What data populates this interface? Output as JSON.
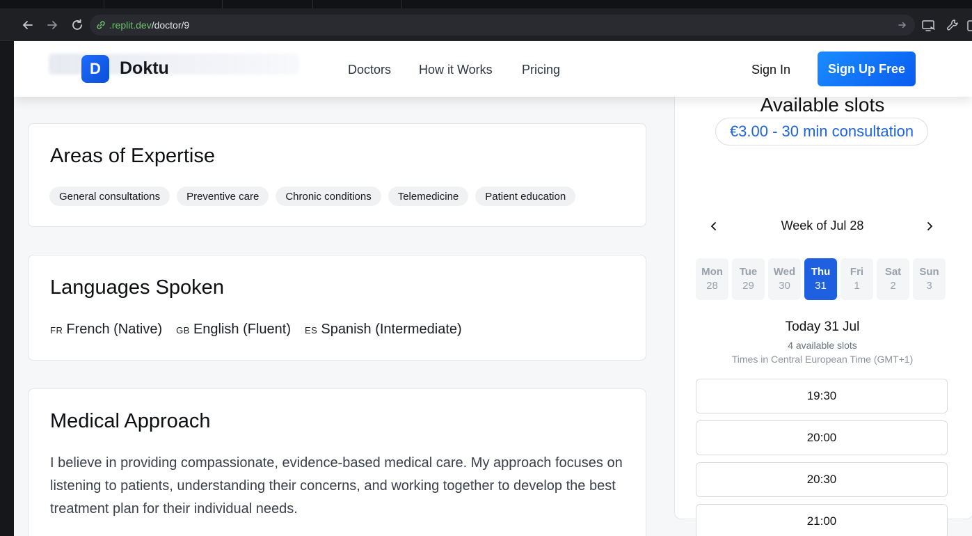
{
  "browser": {
    "url_host": ".replit.dev",
    "url_path": "/doctor/9",
    "icons": [
      "back-arrow-icon",
      "forward-arrow-icon",
      "reload-icon",
      "link-icon",
      "go-arrow-icon",
      "cast-icon",
      "tools-icon"
    ]
  },
  "header": {
    "logo_letter": "D",
    "brand": "Doktu",
    "nav": [
      "Doctors",
      "How it Works",
      "Pricing"
    ],
    "sign_in": "Sign In",
    "sign_up": "Sign Up Free"
  },
  "expertise": {
    "title": "Areas of Expertise",
    "tags": [
      "General consultations",
      "Preventive care",
      "Chronic conditions",
      "Telemedicine",
      "Patient education"
    ]
  },
  "languages": {
    "title": "Languages Spoken",
    "items": [
      {
        "code": "FR",
        "label": "French (Native)"
      },
      {
        "code": "GB",
        "label": "English (Fluent)"
      },
      {
        "code": "ES",
        "label": "Spanish (Intermediate)"
      }
    ]
  },
  "approach": {
    "title": "Medical Approach",
    "text": "I believe in providing compassionate, evidence-based medical care. My approach focuses on listening to patients, understanding their concerns, and working together to develop the best treatment plan for their individual needs."
  },
  "booking": {
    "title": "Available slots",
    "price": "€3.00 - 30 min consultation",
    "week_label": "Week of Jul 28",
    "days": [
      {
        "dow": "Mon",
        "date": "28",
        "selected": false
      },
      {
        "dow": "Tue",
        "date": "29",
        "selected": false
      },
      {
        "dow": "Wed",
        "date": "30",
        "selected": false
      },
      {
        "dow": "Thu",
        "date": "31",
        "selected": true
      },
      {
        "dow": "Fri",
        "date": "1",
        "selected": false
      },
      {
        "dow": "Sat",
        "date": "2",
        "selected": false
      },
      {
        "dow": "Sun",
        "date": "3",
        "selected": false
      }
    ],
    "today_label": "Today 31 Jul",
    "available_count": "4 available slots",
    "timezone": "Times in Central European Time (GMT+1)",
    "slots": [
      "19:30",
      "20:00",
      "20:30",
      "21:00"
    ]
  },
  "colors": {
    "accent": "#1f60e0",
    "brand_gradient_start": "#1a8cff",
    "price_text": "#1e63e0",
    "url_host": "#6cc36b"
  }
}
